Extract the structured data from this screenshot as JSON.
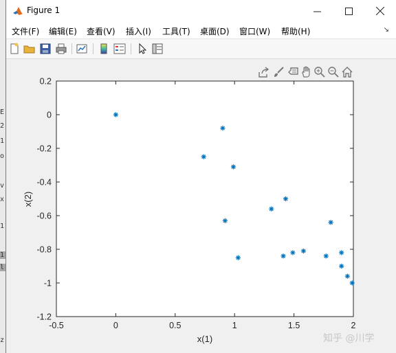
{
  "window": {
    "title": "Figure 1"
  },
  "menu": {
    "items": [
      "文件(F)",
      "编辑(E)",
      "查看(V)",
      "插入(I)",
      "工具(T)",
      "桌面(D)",
      "窗口(W)",
      "帮助(H)"
    ]
  },
  "toolbar": {
    "buttons": [
      "new-figure-icon",
      "open-file-icon",
      "save-icon",
      "print-icon",
      "link-plot-icon",
      "colorbar-icon",
      "legend-icon",
      "edit-plot-icon",
      "property-inspector-icon"
    ]
  },
  "axes_toolbar": {
    "buttons": [
      "export-icon",
      "brush-icon",
      "data-tips-icon",
      "pan-icon",
      "zoom-in-icon",
      "zoom-out-icon",
      "home-icon"
    ]
  },
  "background_window": {
    "text": [
      "E",
      "2",
      "1",
      "o",
      "v",
      "x",
      "1",
      "1",
      "l",
      "z"
    ]
  },
  "watermark": "知乎 @川学",
  "chart_data": {
    "type": "scatter",
    "marker": "*",
    "color": "#0072BD",
    "xlabel": "x(1)",
    "ylabel": "x(2)",
    "xlim": [
      -0.5,
      2
    ],
    "ylim": [
      -1.2,
      0.2
    ],
    "xticks": [
      -0.5,
      0,
      0.5,
      1,
      1.5,
      2
    ],
    "yticks": [
      0.2,
      0,
      -0.2,
      -0.4,
      -0.6,
      -0.8,
      -1,
      -1.2
    ],
    "xtick_labels": [
      "-0.5",
      "0",
      "0.5",
      "1",
      "1.5",
      "2"
    ],
    "ytick_labels": [
      "0.2",
      "0",
      "-0.2",
      "-0.4",
      "-0.6",
      "-0.8",
      "-1",
      "-1.2"
    ],
    "grid": false,
    "x": [
      0,
      0.74,
      0.9,
      0.99,
      0.92,
      1.03,
      1.31,
      1.43,
      1.41,
      1.49,
      1.58,
      1.77,
      1.81,
      1.9,
      1.9,
      1.95,
      1.99
    ],
    "y": [
      0.0,
      -0.25,
      -0.08,
      -0.31,
      -0.63,
      -0.85,
      -0.56,
      -0.5,
      -0.84,
      -0.82,
      -0.81,
      -0.84,
      -0.64,
      -0.82,
      -0.9,
      -0.96,
      -1.0
    ]
  }
}
